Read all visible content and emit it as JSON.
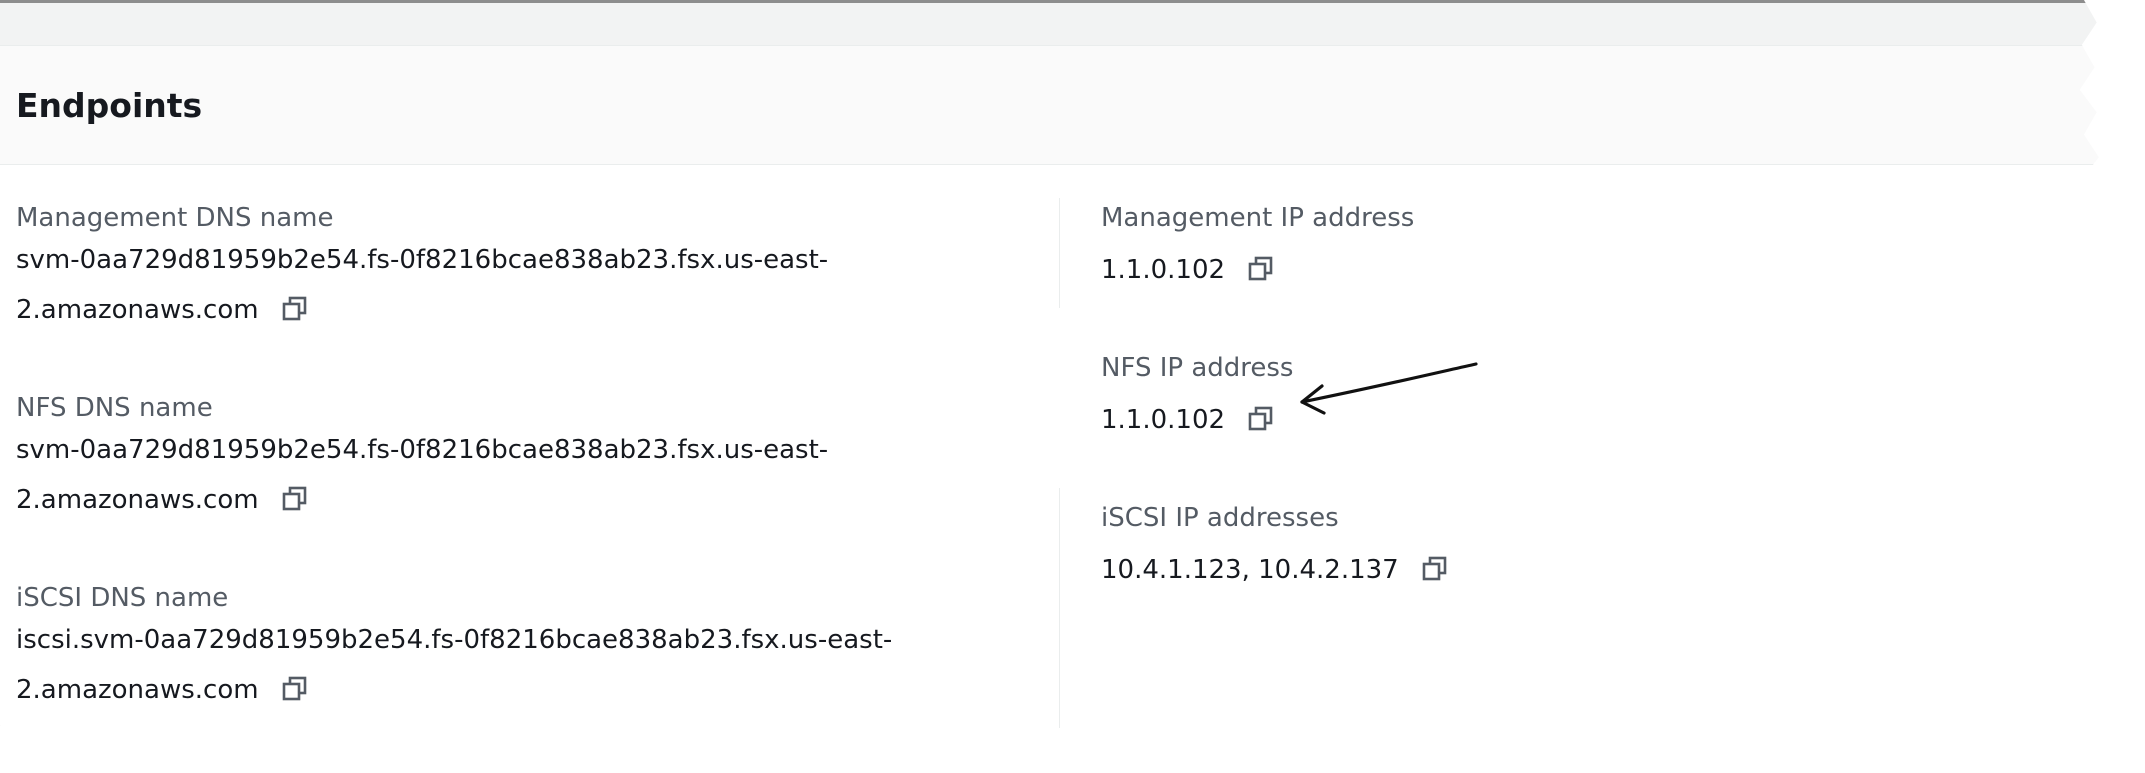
{
  "section": {
    "title": "Endpoints"
  },
  "left_column": {
    "management_dns": {
      "label": "Management DNS name",
      "value_line1": "svm-0aa729d81959b2e54.fs-0f8216bcae838ab23.fsx.us-east-",
      "value_line2": "2.amazonaws.com"
    },
    "nfs_dns": {
      "label": "NFS DNS name",
      "value_line1": "svm-0aa729d81959b2e54.fs-0f8216bcae838ab23.fsx.us-east-",
      "value_line2": "2.amazonaws.com"
    },
    "iscsi_dns": {
      "label": "iSCSI DNS name",
      "value_line1": "iscsi.svm-0aa729d81959b2e54.fs-0f8216bcae838ab23.fsx.us-east-",
      "value_line2": "2.amazonaws.com"
    }
  },
  "right_column": {
    "management_ip": {
      "label": "Management IP address",
      "value": "1.1.0.102"
    },
    "nfs_ip": {
      "label": "NFS IP address",
      "value": "1.1.0.102"
    },
    "iscsi_ip": {
      "label": "iSCSI IP addresses",
      "value": "10.4.1.123, 10.4.2.137"
    }
  },
  "icons": {
    "copy": "copy-icon",
    "annotation": "arrow-icon"
  },
  "colors": {
    "label": "#545b64",
    "value": "#16191f",
    "header_bg": "#fafafa"
  }
}
